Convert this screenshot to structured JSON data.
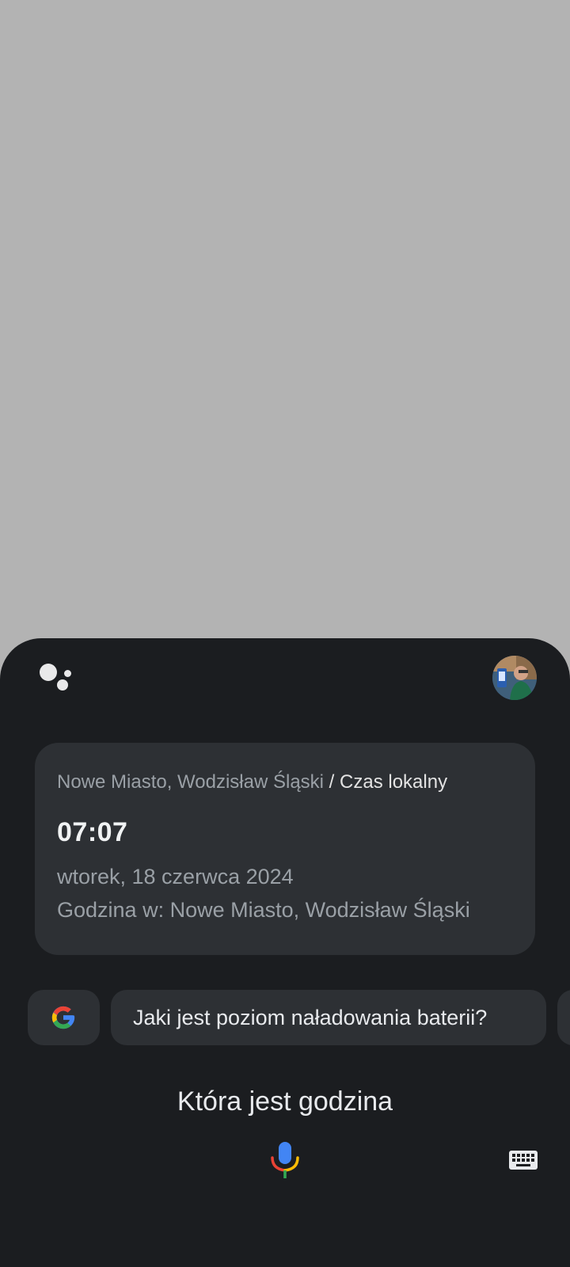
{
  "assistant": {
    "logo_icon": "google-assistant-dots-icon",
    "avatar_icon": "user-avatar"
  },
  "answer_card": {
    "location": "Nowe Miasto, Wodzisław Śląski",
    "source_sep": " / ",
    "source_label": "Czas lokalny",
    "time": "07:07",
    "date": "wtorek, 18 czerwca 2024",
    "place_line": "Godzina w: Nowe Miasto, Wodzisław Śląski"
  },
  "suggestions": {
    "google_icon": "google-g-icon",
    "items": [
      "Jaki jest poziom naładowania baterii?"
    ]
  },
  "query": {
    "text": "Która jest godzina"
  },
  "controls": {
    "mic_icon": "microphone-icon",
    "keyboard_icon": "keyboard-icon"
  },
  "colors": {
    "sheet_bg": "#1b1d20",
    "card_bg": "#2d3034",
    "scrim": "#b3b3b3",
    "google_blue": "#4285f4",
    "google_red": "#ea4335",
    "google_yellow": "#fbbc05",
    "google_green": "#34a853"
  }
}
